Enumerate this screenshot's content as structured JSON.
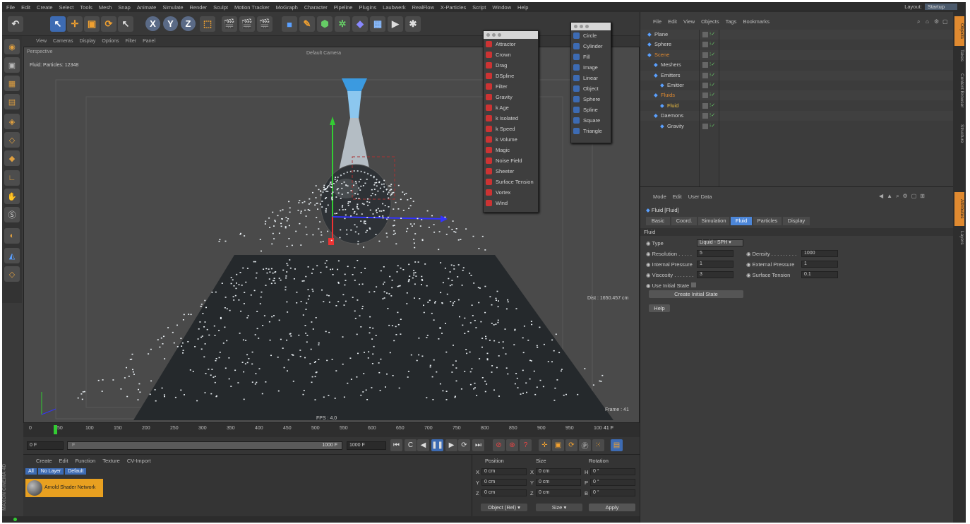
{
  "menubar": {
    "items": [
      "File",
      "Edit",
      "Create",
      "Select",
      "Tools",
      "Mesh",
      "Snap",
      "Animate",
      "Simulate",
      "Render",
      "Sculpt",
      "Motion Tracker",
      "MoGraph",
      "Character",
      "Pipeline",
      "Plugins",
      "Laubwerk",
      "RealFlow",
      "X-Particles",
      "Script",
      "Window",
      "Help"
    ],
    "layout_label": "Layout:",
    "layout_value": "Startup"
  },
  "viewport": {
    "menu": [
      "View",
      "Cameras",
      "Display",
      "Options",
      "Filter",
      "Panel"
    ],
    "name": "Perspective",
    "camera": "Default Camera",
    "particles_info": "Fluid: Particles: 12348",
    "dist": "Dist : 1650.457 cm",
    "fps": "FPS : 4.0",
    "frame": "Frame : 41"
  },
  "modifiers_popup": {
    "items": [
      "Attractor",
      "Crown",
      "Drag",
      "DSpline",
      "Filter",
      "Gravity",
      "k Age",
      "k Isolated",
      "k Speed",
      "k Volume",
      "Magic",
      "Noise Field",
      "Sheeter",
      "Surface Tension",
      "Vortex",
      "Wind"
    ]
  },
  "shapes_popup": {
    "items": [
      "Circle",
      "Cylinder",
      "Fill",
      "Image",
      "Linear",
      "Object",
      "Sphere",
      "Spline",
      "Square",
      "Triangle"
    ]
  },
  "timeline": {
    "ticks": [
      "0",
      "50",
      "100",
      "150",
      "200",
      "250",
      "300",
      "350",
      "400",
      "450",
      "500",
      "550",
      "600",
      "650",
      "700",
      "750",
      "800",
      "850",
      "900",
      "950",
      "100"
    ],
    "current": "41 F"
  },
  "controls": {
    "start": "0 F",
    "range_end": "1000 F",
    "end": "1000 F",
    "range_start": "F"
  },
  "materials": {
    "menu": [
      "Create",
      "Edit",
      "Function",
      "Texture",
      "CV-Import"
    ],
    "filters": [
      "All",
      "No Layer",
      "Default"
    ],
    "material": "Arnold Shader Network"
  },
  "coords": {
    "headers": [
      "Position",
      "Size",
      "Rotation"
    ],
    "rows": [
      {
        "axis": "X",
        "pos": "0 cm",
        "saxis": "X",
        "size": "0 cm",
        "raxis": "H",
        "rot": "0 °"
      },
      {
        "axis": "Y",
        "pos": "0 cm",
        "saxis": "Y",
        "size": "0 cm",
        "raxis": "P",
        "rot": "0 °"
      },
      {
        "axis": "Z",
        "pos": "0 cm",
        "saxis": "Z",
        "size": "0 cm",
        "raxis": "B",
        "rot": "0 °"
      }
    ],
    "mode": "Object (Rel)",
    "size_mode": "Size",
    "apply": "Apply"
  },
  "object_manager": {
    "menu": [
      "File",
      "Edit",
      "View",
      "Objects",
      "Tags",
      "Bookmarks"
    ],
    "objects": [
      {
        "name": "Plane",
        "indent": 0,
        "color": "#cfcfcf"
      },
      {
        "name": "Sphere",
        "indent": 0,
        "color": "#cfcfcf"
      },
      {
        "name": "Scene",
        "indent": 0,
        "color": "#e08a30"
      },
      {
        "name": "Meshers",
        "indent": 1,
        "color": "#cfcfcf"
      },
      {
        "name": "Emitters",
        "indent": 1,
        "color": "#cfcfcf"
      },
      {
        "name": "Emitter",
        "indent": 2,
        "color": "#cfcfcf"
      },
      {
        "name": "Fluids",
        "indent": 1,
        "color": "#e08a30"
      },
      {
        "name": "Fluid",
        "indent": 2,
        "color": "#f0c040"
      },
      {
        "name": "Daemons",
        "indent": 1,
        "color": "#cfcfcf"
      },
      {
        "name": "Gravity",
        "indent": 2,
        "color": "#cfcfcf"
      }
    ]
  },
  "attributes": {
    "menu": [
      "Mode",
      "Edit",
      "User Data"
    ],
    "object_title": "Fluid [Fluid]",
    "tabs": [
      "Basic",
      "Coord.",
      "Simulation",
      "Fluid",
      "Particles",
      "Display"
    ],
    "active_tab": "Fluid",
    "section": "Fluid",
    "type_label": "Type",
    "type_value": "Liquid - SPH",
    "resolution_label": "Resolution",
    "resolution": "5",
    "density_label": "Density",
    "density": "1000",
    "internal_pressure_label": "Internal Pressure",
    "internal_pressure": "1",
    "external_pressure_label": "External Pressure",
    "external_pressure": "1",
    "viscosity_label": "Viscosity",
    "viscosity": "3",
    "surface_tension_label": "Surface Tension",
    "surface_tension": "0.1",
    "use_initial_state": "Use Initial State",
    "create_initial_state": "Create Initial State",
    "help": "Help"
  },
  "right_tabs": [
    "Objects",
    "Takes",
    "Content Browser",
    "Structure",
    "Attributes",
    "Layers"
  ],
  "brand": "MAXON CINEMA 4D"
}
